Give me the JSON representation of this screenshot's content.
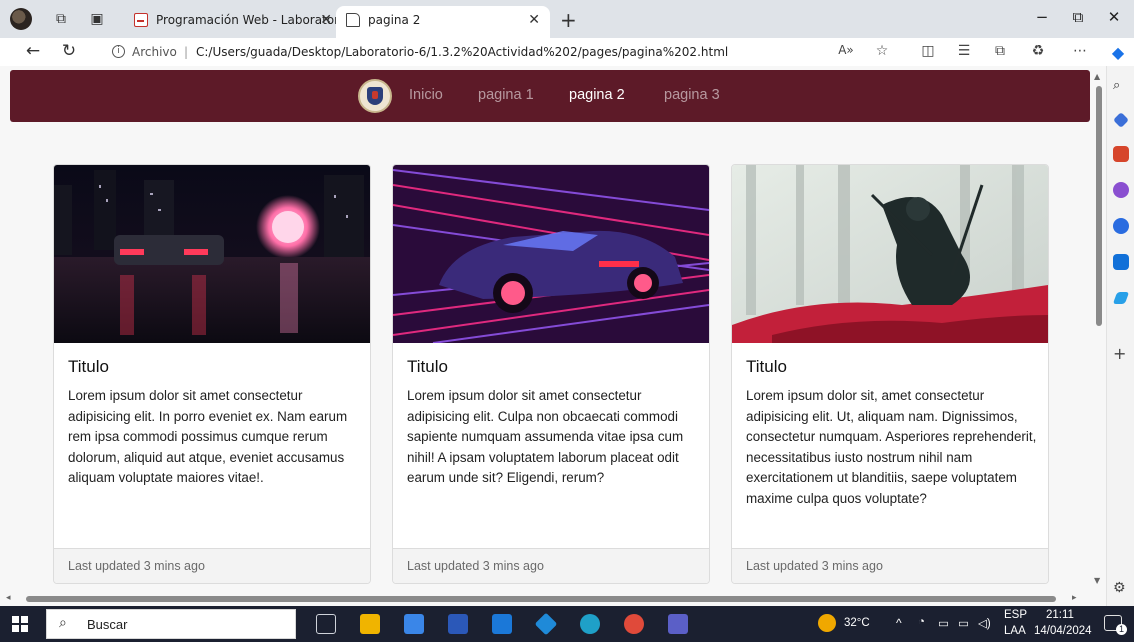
{
  "browser": {
    "tabs": [
      {
        "label": "Programación Web - Laboratorio",
        "active": false
      },
      {
        "label": "pagina 2",
        "active": true
      }
    ],
    "new_tab_icon": "+",
    "window_controls": {
      "minimize": "−",
      "maximize": "⧉",
      "close": "✕"
    },
    "address": {
      "scheme_label": "Archivo",
      "separator": "|",
      "url": "C:/Users/guada/Desktop/Laboratorio-6/1.3.2%20Actividad%202/pages/pagina%202.html"
    }
  },
  "site": {
    "nav": {
      "links": [
        {
          "label": "Inicio",
          "active": false
        },
        {
          "label": "pagina 1",
          "active": false
        },
        {
          "label": "pagina 2",
          "active": true
        },
        {
          "label": "pagina 3",
          "active": false
        }
      ]
    },
    "cards": [
      {
        "title": "Titulo",
        "text": "Lorem ipsum dolor sit amet consectetur adipisicing elit. In porro eveniet ex. Nam earum rem ipsa commodi possimus cumque rerum dolorum, aliquid aut atque, eveniet accusamus aliquam voluptate maiores vitae!.",
        "footer": "Last updated 3 mins ago"
      },
      {
        "title": "Titulo",
        "text": "Lorem ipsum dolor sit amet consectetur adipisicing elit. Culpa non obcaecati commodi sapiente numquam assumenda vitae ipsa cum nihil! A ipsam voluptatem laborum placeat odit earum unde sit? Eligendi, rerum?",
        "footer": "Last updated 3 mins ago"
      },
      {
        "title": "Titulo",
        "text": "Lorem ipsum dolor sit, amet consectetur adipisicing elit. Ut, aliquam nam. Dignissimos, consectetur numquam. Asperiores reprehenderit, necessitatibus iusto nostrum nihil nam exercitationem ut blanditiis, saepe voluptatem maxime culpa quos voluptate?",
        "footer": "Last updated 3 mins ago"
      }
    ]
  },
  "taskbar": {
    "search_label": "Buscar",
    "weather": "32°C",
    "language": [
      "ESP",
      "LAA"
    ],
    "time": "21:11",
    "date": "14/04/2024",
    "notification_count": "1"
  }
}
